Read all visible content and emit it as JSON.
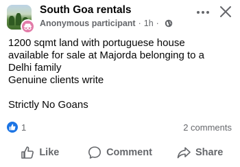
{
  "header": {
    "group_name": "South Goa rentals",
    "author": "Anonymous participant",
    "separator": "·",
    "time": "1h",
    "icons": {
      "more": "more-horizontal-icon",
      "close": "close-icon",
      "audience": "globe-icon"
    }
  },
  "post": {
    "lines": [
      "1200 sqmt land with portuguese house",
      "available for sale at Majorda belonging to a",
      "Delhi family",
      "Genuine clients write"
    ],
    "final_line": "Strictly No Goans"
  },
  "stats": {
    "reaction_count": "1",
    "comments": "2 comments"
  },
  "actions": {
    "like": "Like",
    "comment": "Comment",
    "share": "Share"
  },
  "colors": {
    "secondary_text": "#65676b",
    "like_blue": "#1b74e4",
    "anonymous_pink": "#e27ba8"
  }
}
